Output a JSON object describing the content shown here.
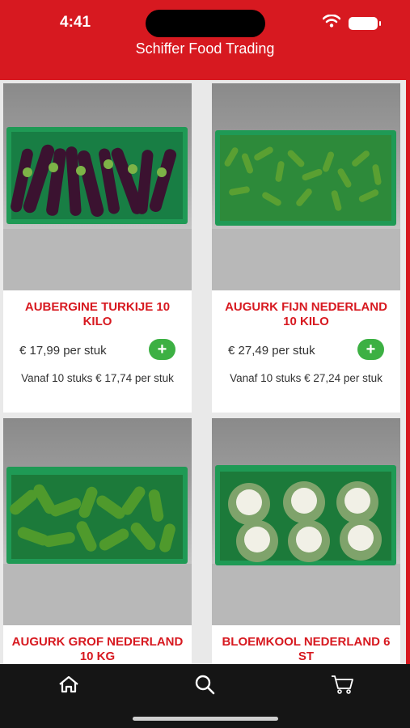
{
  "status_bar": {
    "time": "4:41",
    "icons": [
      "wifi-icon",
      "battery-icon"
    ]
  },
  "header": {
    "title": "Schiffer Food Trading"
  },
  "colors": {
    "brand_red": "#d71920",
    "add_green": "#3cb043",
    "product_red": "#d71920",
    "tabbar_bg": "#151515"
  },
  "products": [
    {
      "name": "AUBERGINE TURKIJE 10 KILO",
      "price": "€ 17,99 per stuk",
      "tier": "Vanaf 10 stuks € 17,74 per stuk",
      "add_label": "+"
    },
    {
      "name": "AUGURK FIJN NEDERLAND 10 KILO",
      "price": "€ 27,49 per stuk",
      "tier": "Vanaf 10 stuks € 27,24 per stuk",
      "add_label": "+"
    },
    {
      "name": "AUGURK GROF NEDERLAND 10 KG",
      "price": "",
      "tier": "",
      "add_label": ""
    },
    {
      "name": "BLOEMKOOL NEDERLAND 6 ST",
      "price": "",
      "tier": "",
      "add_label": ""
    }
  ],
  "tabbar": {
    "items": [
      "home-icon",
      "search-icon",
      "cart-icon"
    ]
  }
}
